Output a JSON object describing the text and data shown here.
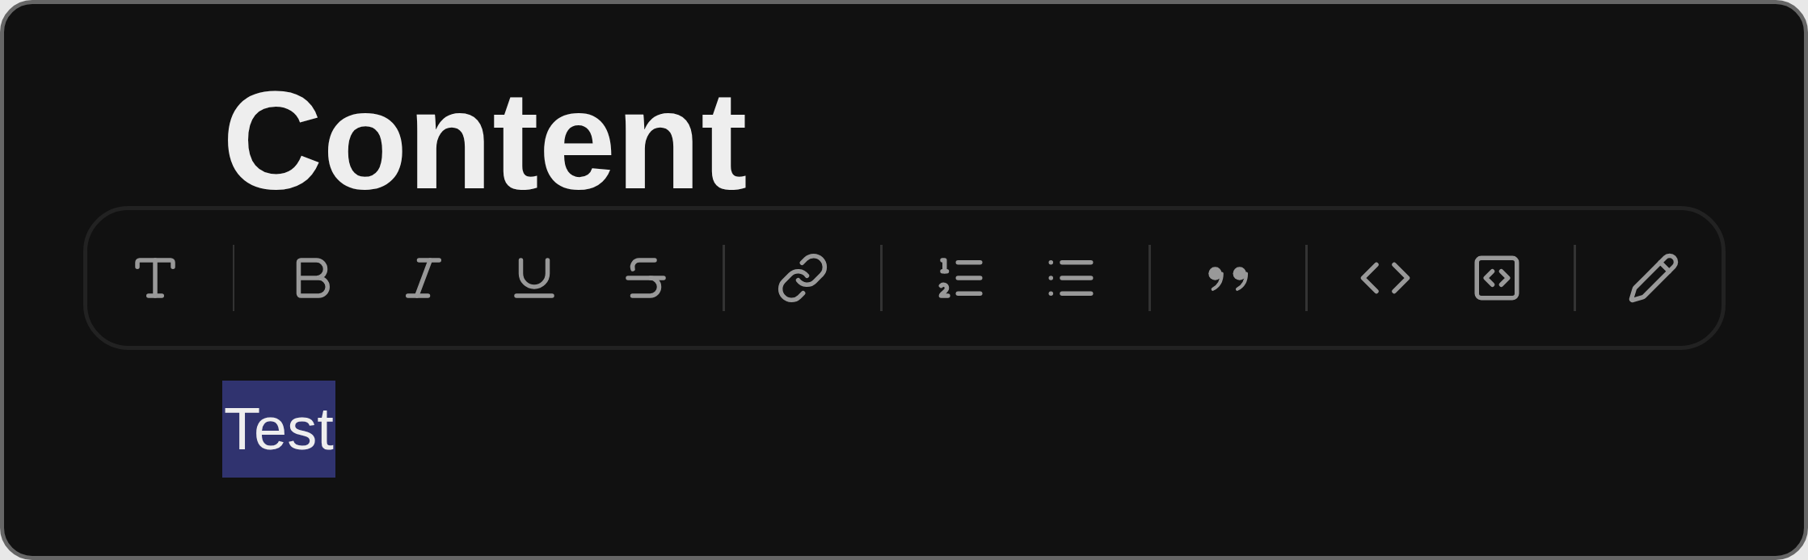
{
  "title": "Content",
  "toolbar": {
    "groups": [
      {
        "tools": [
          {
            "kind": "text"
          }
        ]
      },
      {
        "tools": [
          {
            "kind": "bold"
          },
          {
            "kind": "italic"
          },
          {
            "kind": "underline"
          },
          {
            "kind": "strikethrough"
          }
        ]
      },
      {
        "tools": [
          {
            "kind": "link"
          }
        ]
      },
      {
        "tools": [
          {
            "kind": "ordered-list"
          },
          {
            "kind": "bullet-list"
          }
        ]
      },
      {
        "tools": [
          {
            "kind": "quote"
          }
        ]
      },
      {
        "tools": [
          {
            "kind": "code"
          },
          {
            "kind": "code-block"
          }
        ]
      },
      {
        "tools": [
          {
            "kind": "edit"
          }
        ]
      }
    ]
  },
  "body": {
    "text": "Test",
    "selected": true
  }
}
